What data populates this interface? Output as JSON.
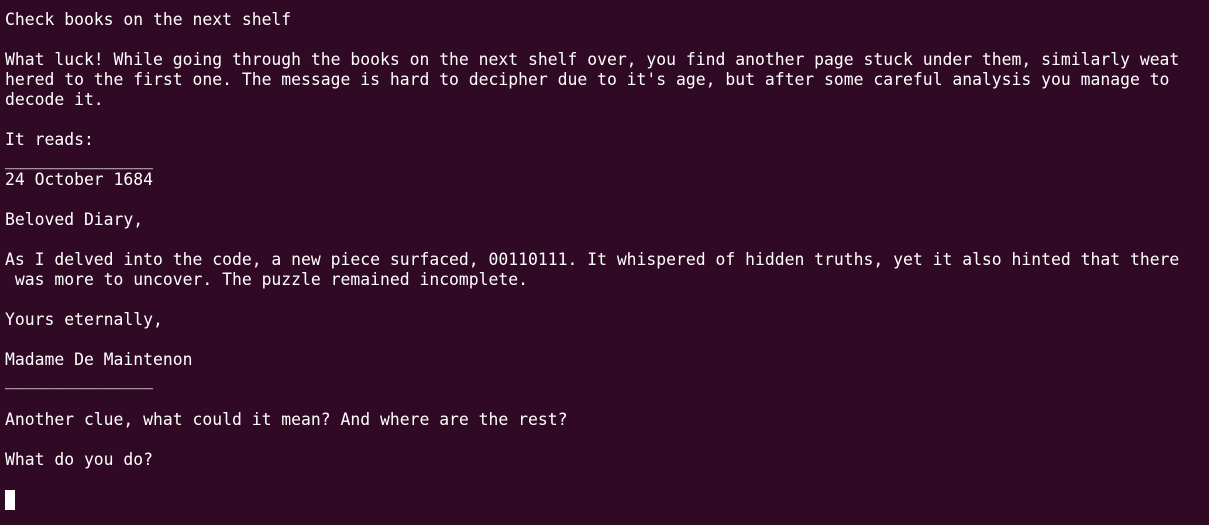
{
  "terminal": {
    "lines": [
      "Check books on the next shelf",
      "",
      "What luck! While going through the books on the next shelf over, you find another page stuck under them, similarly weat",
      "hered to the first one. The message is hard to decipher due to it's age, but after some careful analysis you manage to",
      "decode it.",
      "",
      "It reads:",
      "_______________",
      "24 October 1684",
      "",
      "Beloved Diary,",
      "",
      "As I delved into the code, a new piece surfaced, 00110111. It whispered of hidden truths, yet it also hinted that there",
      " was more to uncover. The puzzle remained incomplete.",
      "",
      "Yours eternally,",
      "",
      "Madame De Maintenon",
      "_______________",
      "",
      "Another clue, what could it mean? And where are the rest?",
      "",
      "What do you do?",
      ""
    ],
    "background_color": "#300a24",
    "text_color": "#ffffff"
  }
}
